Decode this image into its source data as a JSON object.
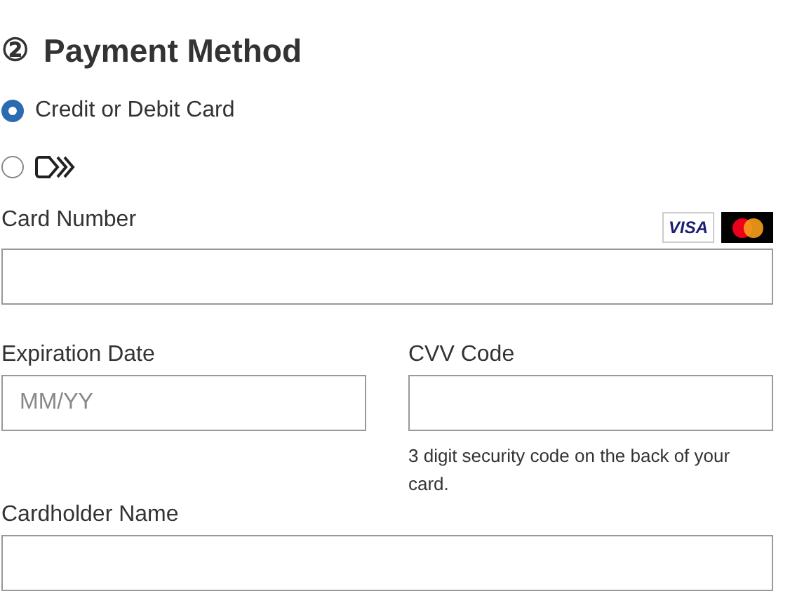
{
  "heading": {
    "step": "②",
    "title": "Payment Method"
  },
  "options": [
    {
      "kind": "text",
      "label": "Credit or Debit Card",
      "selected": true
    },
    {
      "kind": "icon",
      "selected": false
    }
  ],
  "card_number": {
    "label": "Card Number",
    "brands": [
      {
        "kind": "visa",
        "text": "VISA"
      },
      {
        "kind": "mastercard"
      }
    ]
  },
  "expiration": {
    "label": "Expiration Date",
    "placeholder": "MM/YY"
  },
  "cvv": {
    "label": "CVV Code",
    "hint": "3 digit security code on the back of your card."
  },
  "cardholder": {
    "label": "Cardholder Name"
  }
}
